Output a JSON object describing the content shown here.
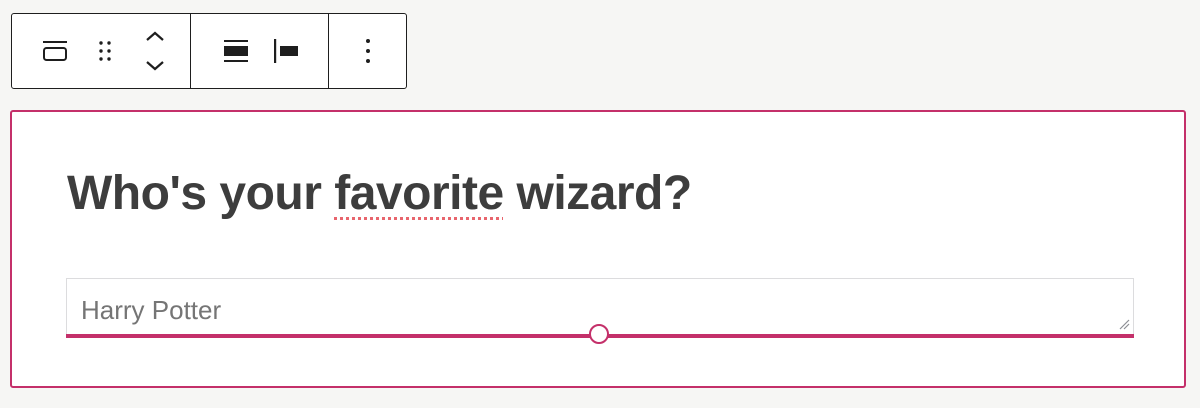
{
  "toolbar": {
    "groups": [
      {
        "buttons": [
          {
            "icon": "block-type-icon",
            "label": "Change block type"
          },
          {
            "icon": "drag-handle-icon",
            "label": "Drag"
          },
          {
            "icon": "move-up-down-icon",
            "label": "Move up / Move down"
          }
        ]
      },
      {
        "buttons": [
          {
            "icon": "align-center-icon",
            "label": "Align"
          },
          {
            "icon": "justify-left-icon",
            "label": "Justify"
          }
        ]
      },
      {
        "buttons": [
          {
            "icon": "more-options-icon",
            "label": "Options"
          }
        ]
      }
    ]
  },
  "block": {
    "question_part1": "Who's your ",
    "question_misspelled": "favorite",
    "question_part2": " wizard?",
    "answer_placeholder": "Harry Potter"
  },
  "colors": {
    "accent": "#c4306a",
    "heading_text": "#3d3d3d",
    "placeholder_text": "#757575",
    "spellcheck_underline": "#e8656d",
    "page_background": "#f6f6f4"
  }
}
